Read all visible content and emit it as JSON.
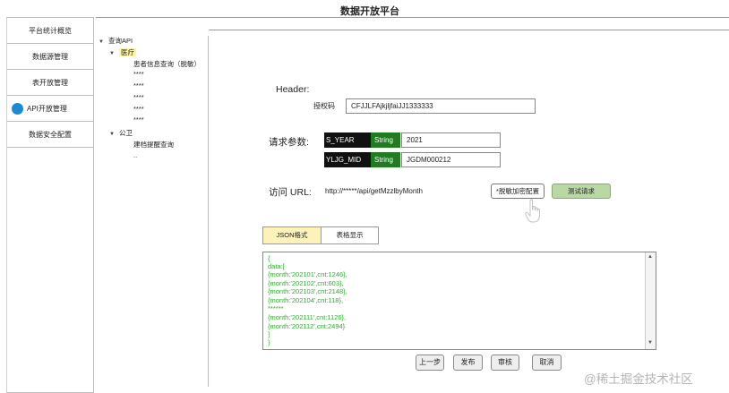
{
  "app": {
    "title": "数据开放平台"
  },
  "nav": {
    "items": [
      {
        "label": "平台统计概览"
      },
      {
        "label": "数据源管理"
      },
      {
        "label": "表开放管理"
      },
      {
        "label": "API开放管理"
      },
      {
        "label": "数据安全配置"
      }
    ],
    "active": "API开放管理"
  },
  "tree": {
    "root": "查询API",
    "medical": "医疗",
    "medical_items": [
      "患者信息查询（脱敏）",
      "****",
      "****",
      "****",
      "****",
      "****"
    ],
    "police": "公卫",
    "police_items": [
      "建档提醒查询",
      ".."
    ]
  },
  "header": {
    "section_label": "Header:",
    "auth_label": "授权码",
    "auth_value": "CFJJLFAjkjljfaiJJ1333333"
  },
  "params": {
    "label": "请求参数:",
    "rows": [
      {
        "name": "S_YEAR",
        "type": "String",
        "value": "2021"
      },
      {
        "name": "YLJG_MID",
        "type": "String",
        "value": "JGDM000212"
      }
    ]
  },
  "url": {
    "label": "访问 URL:",
    "value": "http://*****/api/getMzzlbyMonth",
    "config_button": "*脱敏加密配置",
    "test_button": "测试请求"
  },
  "result": {
    "tabs": [
      "JSON格式",
      "表格显示"
    ],
    "active_tab": "JSON格式",
    "lines": [
      "{",
      "data:[",
      "{month:'202101',cnt:1246},",
      "{month:'202102',cnt:603},",
      "{month:'202103',cnt:2148},",
      "{month:'202104',cnt:118},",
      "******",
      "{month:'202111',cnt:1126},",
      "{month:'202112',cnt:2494}",
      "]",
      "}"
    ]
  },
  "actions": {
    "prev": "上一步",
    "publish": "发布",
    "review": "审核",
    "cancel": "取消"
  },
  "watermark": "@稀土掘金技术社区",
  "colors": {
    "accent_blue": "#1a8ad8",
    "type_green": "#1f7d1f",
    "json_green": "#2fae2f",
    "tab_active": "#fdf2b8",
    "test_button": "#b9d8a3"
  },
  "icons": {
    "nav_active": "circle-icon",
    "tree_expand": "caret-down-icon",
    "pointer": "hand-pointer-icon"
  }
}
